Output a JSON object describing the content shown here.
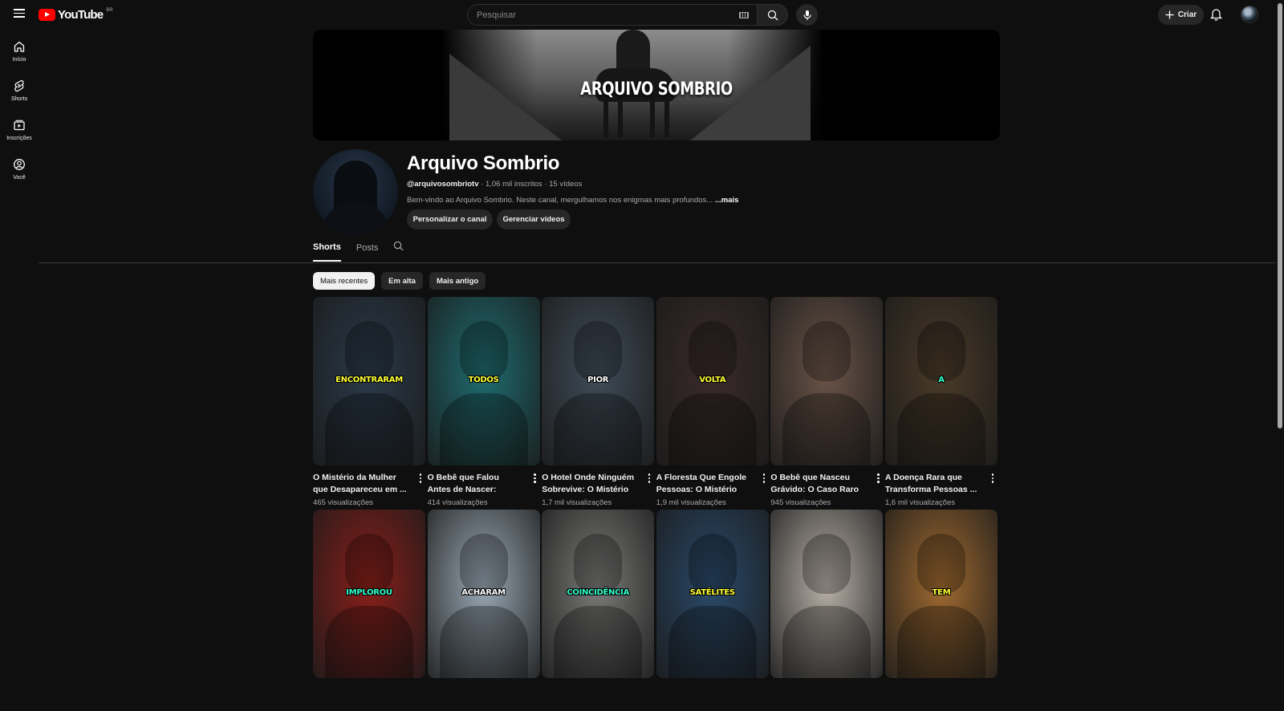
{
  "header": {
    "logo_text": "YouTube",
    "region": "BR",
    "search_placeholder": "Pesquisar",
    "create_label": "Criar"
  },
  "sidebar": {
    "items": [
      {
        "label": "Início",
        "icon": "home-icon"
      },
      {
        "label": "Shorts",
        "icon": "shorts-icon"
      },
      {
        "label": "Inscrições",
        "icon": "subscriptions-icon"
      },
      {
        "label": "Você",
        "icon": "you-icon"
      }
    ]
  },
  "banner": {
    "title": "ARQUIVO SOMBRIO"
  },
  "channel": {
    "name": "Arquivo Sombrio",
    "handle": "@arquivosombriotv",
    "meta": " · 1,06 mil inscritos · 15 vídeos",
    "description": "Bem-vindo ao Arquivo Sombrio. Neste canal, mergulhamos nos enigmas mais profundos...",
    "more_label": "...mais",
    "customize_label": "Personalizar o canal",
    "manage_label": "Gerenciar vídeos"
  },
  "tabs": [
    {
      "label": "Shorts",
      "active": true
    },
    {
      "label": "Posts",
      "active": false
    }
  ],
  "chips": [
    {
      "label": "Mais recentes",
      "active": true
    },
    {
      "label": "Em alta",
      "active": false
    },
    {
      "label": "Mais antigo",
      "active": false
    }
  ],
  "shorts": [
    {
      "overlay": "ENCONTRARAM",
      "title": "O Mistério da Mulher que Desapareceu em ...",
      "views": "465 visualizações",
      "overlay_color": "#ffff33",
      "theme": "#2a3a4a"
    },
    {
      "overlay": "TODOS",
      "title": "O Bebê que Falou Antes de Nascer: Mistério ou...",
      "views": "414 visualizações",
      "overlay_color": "#ffff33",
      "theme": "#1f6c70"
    },
    {
      "overlay": "PIOR",
      "title": "O Hotel Onde Ninguém Sobrevive: O Mistério ...",
      "views": "1,7 mil visualizações",
      "overlay_color": "#ffffff",
      "theme": "#3f4c58"
    },
    {
      "overlay": "VOLTA",
      "title": "A Floresta Que Engole Pessoas: O Mistério d...",
      "views": "1,9 mil visualizações",
      "overlay_color": "#ffff33",
      "theme": "#3a2a2a"
    },
    {
      "overlay": "",
      "title": "O Bebê que Nasceu Grávido: O Caso Raro ...",
      "views": "945 visualizações",
      "overlay_color": "#ffff33",
      "theme": "#6a5448"
    },
    {
      "overlay": "A",
      "title": "A Doença Rara que Transforma Pessoas ...",
      "views": "1,6 mil visualizações",
      "overlay_color": "#33ffcc",
      "theme": "#4a3a28"
    },
    {
      "overlay": "IMPLOROU",
      "title": "",
      "views": "",
      "overlay_color": "#33ffcc",
      "theme": "#8a1f1a"
    },
    {
      "overlay": "ACHARAM",
      "title": "",
      "views": "",
      "overlay_color": "#ffffff",
      "theme": "#9aa9b5"
    },
    {
      "overlay": "COINCIDÊNCIA",
      "title": "",
      "views": "",
      "overlay_color": "#33ffcc",
      "theme": "#7a7a78"
    },
    {
      "overlay": "SATÉLITES",
      "title": "",
      "views": "",
      "overlay_color": "#ffff33",
      "theme": "#2a4a6a"
    },
    {
      "overlay": "",
      "title": "",
      "views": "",
      "overlay_color": "#33ffcc",
      "theme": "#b8b0a8"
    },
    {
      "overlay": "TEM",
      "title": "",
      "views": "",
      "overlay_color": "#ffff33",
      "theme": "#a06a30"
    }
  ]
}
